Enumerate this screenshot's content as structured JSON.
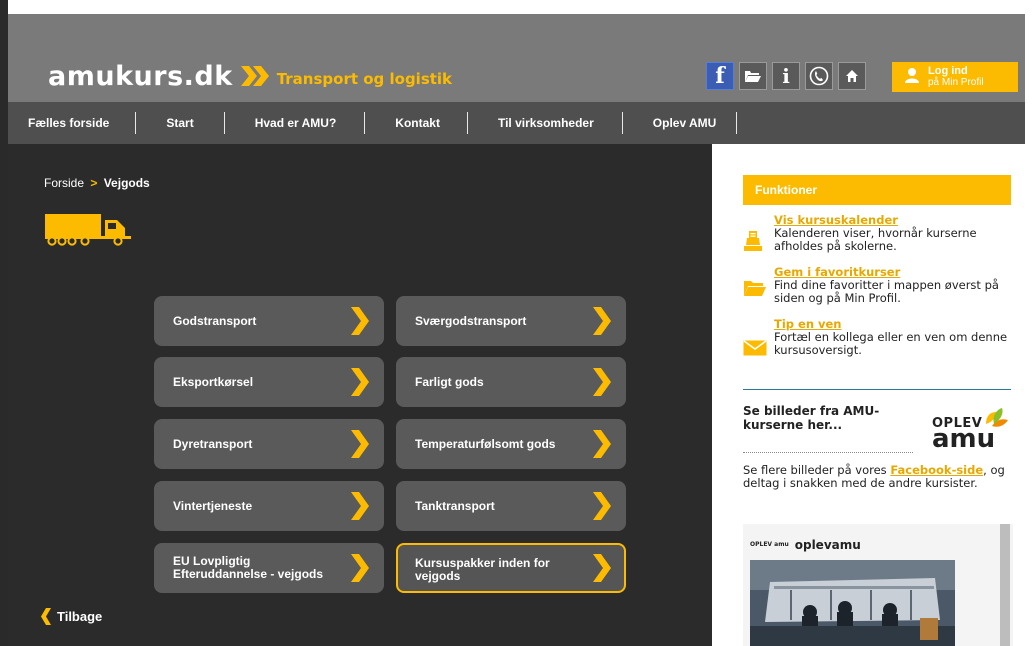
{
  "header": {
    "logo_text": "amukurs.dk",
    "logo_subtitle": "Transport og logistik",
    "icons": [
      "facebook-icon",
      "folder-icon",
      "info-icon",
      "phone-icon",
      "home-icon"
    ],
    "facebook_glyph": "f",
    "info_glyph": "i",
    "login_title": "Log ind",
    "login_subtitle": "på Min Profil"
  },
  "nav": {
    "items": [
      "Fælles forside",
      "Start",
      "Hvad er AMU?",
      "Kontakt",
      "Til virksomheder",
      "Oplev AMU"
    ]
  },
  "breadcrumb": {
    "home": "Forside",
    "separator": ">",
    "current": "Vejgods"
  },
  "tiles": [
    {
      "label": "Godstransport"
    },
    {
      "label": "Sværgodstransport"
    },
    {
      "label": "Eksportkørsel"
    },
    {
      "label": "Farligt gods"
    },
    {
      "label": "Dyretransport"
    },
    {
      "label": "Temperaturfølsomt gods"
    },
    {
      "label": "Vintertjeneste"
    },
    {
      "label": "Tanktransport"
    },
    {
      "label": "EU Lovpligtig Efteruddannelse - vejgods"
    },
    {
      "label": "Kursuspakker inden for vejgods",
      "active": true
    }
  ],
  "back_label": "Tilbage",
  "sidebar": {
    "functions_title": "Funktioner",
    "functions": [
      {
        "link": "Vis kursuskalender",
        "text": "Kalenderen viser, hvornår kurserne afholdes på skolerne.",
        "icon": "calendar-icon"
      },
      {
        "link": "Gem i favoritkurser",
        "text": "Find dine favoritter i mappen øverst på siden og på Min Profil.",
        "icon": "folder-icon"
      },
      {
        "link": "Tip en ven",
        "text": "Fortæl en kollega eller en ven om denne kursusoversigt.",
        "icon": "mail-icon"
      }
    ],
    "see_title": "Se billeder fra AMU-kurserne her...",
    "oplev_logo_line1": "OPLEV",
    "oplev_logo_line2": "amu",
    "fb_text_before": "Se flere billeder på vores ",
    "fb_link": "Facebook-side",
    "fb_text_after": ", og deltag i snakken med de andre kursister.",
    "feed_account": "oplevamu",
    "feed_account_mini": "OPLEV amu"
  },
  "colors": {
    "accent": "#fcbb00",
    "header_bg": "#7a7a7a",
    "nav_bg": "#4f4f4f",
    "main_bg": "#2b2b2b",
    "tile_bg": "#5a5a5a",
    "facebook": "#3b5db3"
  }
}
